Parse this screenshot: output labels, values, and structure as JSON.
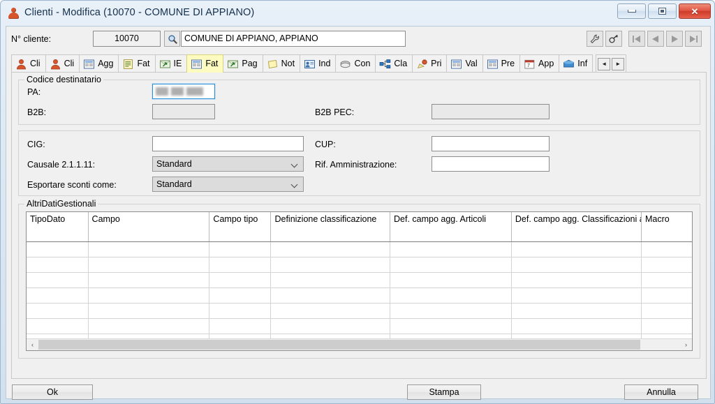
{
  "window": {
    "title": "Clienti - Modifica (10070 - COMUNE DI APPIANO)",
    "icon": "user-icon",
    "minimize_label": "–",
    "maximize_label": "□",
    "close_label": "✕"
  },
  "client_bar": {
    "label": "N° cliente:",
    "number_value": "10070",
    "number_placeholder": "",
    "lookup_icon": "search-icon",
    "name_value": "COMUNE DI APPIANO, APPIANO",
    "name_placeholder": ""
  },
  "toolbar_right": {
    "buttons": [
      {
        "name": "tools-wrench-icon",
        "glyph": "wrench",
        "enabled": true
      },
      {
        "name": "goto-link-icon",
        "glyph": "link",
        "enabled": true
      },
      {
        "name": "first-record-icon",
        "glyph": "first",
        "enabled": false
      },
      {
        "name": "previous-record-icon",
        "glyph": "prev",
        "enabled": false
      },
      {
        "name": "next-record-icon",
        "glyph": "next",
        "enabled": false
      },
      {
        "name": "last-record-icon",
        "glyph": "last",
        "enabled": false
      }
    ]
  },
  "tabs": {
    "items": [
      {
        "label": "Cli",
        "icon": "user-icon",
        "active": false
      },
      {
        "label": "Cli",
        "icon": "user-icon",
        "active": false
      },
      {
        "label": "Agg",
        "icon": "form-icon",
        "active": false
      },
      {
        "label": "Fat",
        "icon": "document-icon",
        "active": false
      },
      {
        "label": "IE",
        "icon": "import-export-icon",
        "active": false
      },
      {
        "label": "Fat",
        "icon": "invoice-icon",
        "active": true
      },
      {
        "label": "Pag",
        "icon": "payment-icon",
        "active": false
      },
      {
        "label": "Not",
        "icon": "note-icon",
        "active": false
      },
      {
        "label": "Ind",
        "icon": "address-icon",
        "active": false
      },
      {
        "label": "Con",
        "icon": "contact-icon",
        "active": false
      },
      {
        "label": "Cla",
        "icon": "classification-icon",
        "active": false
      },
      {
        "label": "Pri",
        "icon": "priority-icon",
        "active": false
      },
      {
        "label": "Val",
        "icon": "values-icon",
        "active": false
      },
      {
        "label": "Pre",
        "icon": "prices-icon",
        "active": false
      },
      {
        "label": "App",
        "icon": "calendar-icon",
        "active": false
      },
      {
        "label": "Inf",
        "icon": "info-icon",
        "active": false
      }
    ],
    "nav_prev_label": "◄",
    "nav_next_label": "►"
  },
  "codice_destinatario": {
    "group_title": "Codice destinatario",
    "pa_label": "PA:",
    "pa_value": "",
    "pa_redacted": true,
    "b2b_label": "B2B:",
    "b2b_value": "",
    "b2b_pec_label": "B2B PEC:",
    "b2b_pec_value": ""
  },
  "fattura_group": {
    "cig_label": "CIG:",
    "cig_value": "",
    "cup_label": "CUP:",
    "cup_value": "",
    "causale_label": "Causale 2.1.1.11:",
    "causale_value": "Standard",
    "causale_options": [
      "Standard"
    ],
    "rif_amministrazione_label": "Rif. Amministrazione:",
    "rif_amministrazione_value": "",
    "esportare_sconti_label": "Esportare sconti come:",
    "esportare_sconti_value": "Standard",
    "esportare_sconti_options": [
      "Standard"
    ]
  },
  "altri_dati": {
    "group_title": "AltriDatiGestionali",
    "columns": [
      "TipoDato",
      "Campo",
      "Campo tipo",
      "Definizione classificazione",
      "Def. campo agg. Articoli",
      "Def. campo agg. Classificazioni articoli",
      "Macro"
    ],
    "rows": [
      [
        "",
        "",
        "",
        "",
        "",
        "",
        ""
      ],
      [
        "",
        "",
        "",
        "",
        "",
        "",
        ""
      ],
      [
        "",
        "",
        "",
        "",
        "",
        "",
        ""
      ],
      [
        "",
        "",
        "",
        "",
        "",
        "",
        ""
      ],
      [
        "",
        "",
        "",
        "",
        "",
        "",
        ""
      ],
      [
        "",
        "",
        "",
        "",
        "",
        "",
        ""
      ],
      [
        "",
        "",
        "",
        "",
        "",
        "",
        ""
      ]
    ],
    "scroll_left_label": "‹",
    "scroll_right_label": "›"
  },
  "footer": {
    "ok_label": "Ok",
    "stampa_label": "Stampa",
    "annulla_label": "Annulla"
  },
  "colors": {
    "active_tab": "#fdfbbf",
    "title_text": "#15304d",
    "close_button": "#cd3a28",
    "focus_border": "#2a8cd6"
  }
}
